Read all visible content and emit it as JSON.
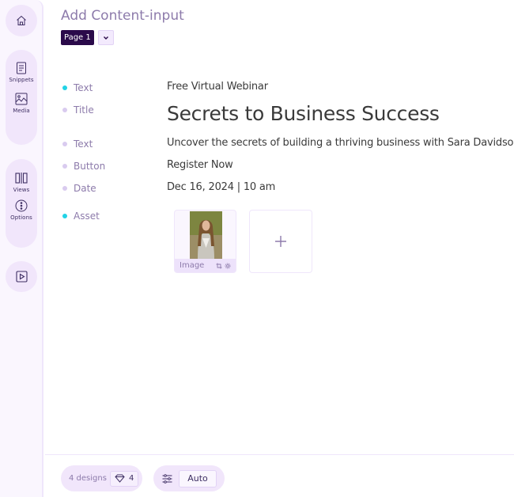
{
  "sidebar": {
    "items": [
      {
        "icon": "home-icon",
        "label": ""
      },
      {
        "icon": "snippets-icon",
        "label": "Snippets"
      },
      {
        "icon": "media-icon",
        "label": "Media"
      },
      {
        "icon": "views-icon",
        "label": "Views"
      },
      {
        "icon": "options-icon",
        "label": "Options"
      },
      {
        "icon": "preview-play-icon",
        "label": ""
      }
    ]
  },
  "header": {
    "title": "Add Content-input",
    "page_selector": "Page 1"
  },
  "fields": [
    {
      "type": "Text",
      "active": true,
      "value": "Free Virtual Webinar"
    },
    {
      "type": "Title",
      "active": false,
      "value": "Secrets to Business Success"
    },
    {
      "type": "Text",
      "active": false,
      "value": "Uncover the secrets of building a thriving business with Sara Davidson."
    },
    {
      "type": "Button",
      "active": false,
      "value": "Register Now"
    },
    {
      "type": "Date",
      "active": false,
      "value": "Dec 16, 2024 | 10 am"
    },
    {
      "type": "Asset",
      "active": true,
      "value": ""
    }
  ],
  "assets": {
    "items": [
      {
        "label": "Image",
        "kind": "photo"
      }
    ],
    "add_symbol": "+"
  },
  "footer": {
    "designs_label": "4 designs",
    "designs_count": "4",
    "auto_label": "Auto"
  },
  "colors": {
    "accent_dark": "#2a0a4a",
    "active_dot": "#22d3e6",
    "idle_dot": "#d9cbef",
    "lavender": "#f1e6fb",
    "label_purple": "#8d7bab"
  }
}
